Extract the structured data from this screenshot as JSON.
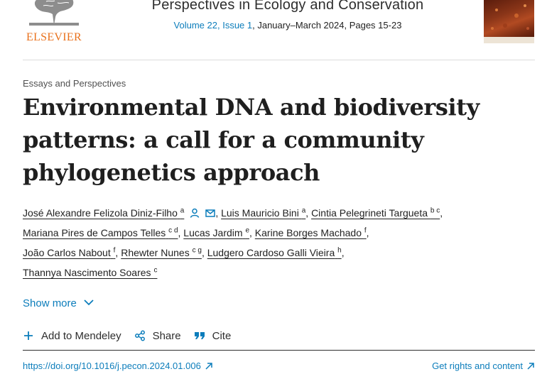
{
  "publisher": {
    "logo_text": "ELSEVIER"
  },
  "journal": {
    "title": "Perspectives in Ecology and Conservation",
    "volume_link": "Volume 22, Issue 1",
    "issue_date": ", January–March 2024, Pages 15-23"
  },
  "article": {
    "type": "Essays and Perspectives",
    "title_lines": [
      "Environmental DNA and biodiversity",
      "patterns: a call for a community",
      "phylogenetics approach"
    ]
  },
  "authors": [
    {
      "name": "José Alexandre Felizola Diniz-Filho",
      "aff": "a"
    },
    {
      "name": "Luis Mauricio Bini",
      "aff": "a"
    },
    {
      "name": "Cintia Pelegrineti Targueta",
      "aff": "b c"
    },
    {
      "name": "Mariana Pires de Campos Telles",
      "aff": "c d"
    },
    {
      "name": "Lucas Jardim",
      "aff": "e"
    },
    {
      "name": "Karine Borges Machado",
      "aff": "f"
    },
    {
      "name": "João Carlos Nabout",
      "aff": "f"
    },
    {
      "name": "Rhewter Nunes",
      "aff": "c g"
    },
    {
      "name": "Ludgero Cardoso Galli Vieira",
      "aff": "h"
    },
    {
      "name": "Thannya Nascimento Soares",
      "aff": "c"
    }
  ],
  "show_more": {
    "label": "Show more"
  },
  "actions": {
    "mendeley": "Add to Mendeley",
    "share": "Share",
    "cite": "Cite"
  },
  "links": {
    "doi": "https://doi.org/10.1016/j.pecon.2024.01.006",
    "rights": "Get rights and content"
  },
  "colors": {
    "link": "#0c7dbb",
    "brand_orange": "#e9711c",
    "text": "#1f1f1f"
  }
}
